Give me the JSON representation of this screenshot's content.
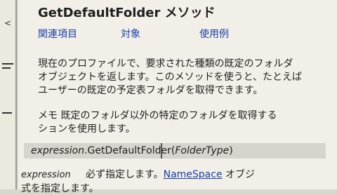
{
  "left_pane": {
    "caret": "<"
  },
  "title": "GetDefaultFolder メソッド",
  "related": [
    "関連項目",
    "対象",
    "使用例"
  ],
  "description": {
    "line1": "現在のプロファイルで、要求された種類の既定のフォルダ",
    "line2": "オブジェクトを返します。このメソッドを使うと、たとえば",
    "line3": "ユーザーの既定の予定表フォルダを取得できます。"
  },
  "note": {
    "line1": "メモ  既定のフォルダ以外の特定のフォルダを取得する",
    "line2": "ションを使用します。"
  },
  "syntax": {
    "expression": "expression",
    "dot_method": ".GetDefaultFolder(",
    "param": "FolderType",
    "close": ")"
  },
  "parameter": {
    "name": "expression",
    "desc_before": "必ず指定します。",
    "link": "NameSpace",
    "desc_after": " オブジ",
    "cont": "式を指定します。"
  }
}
